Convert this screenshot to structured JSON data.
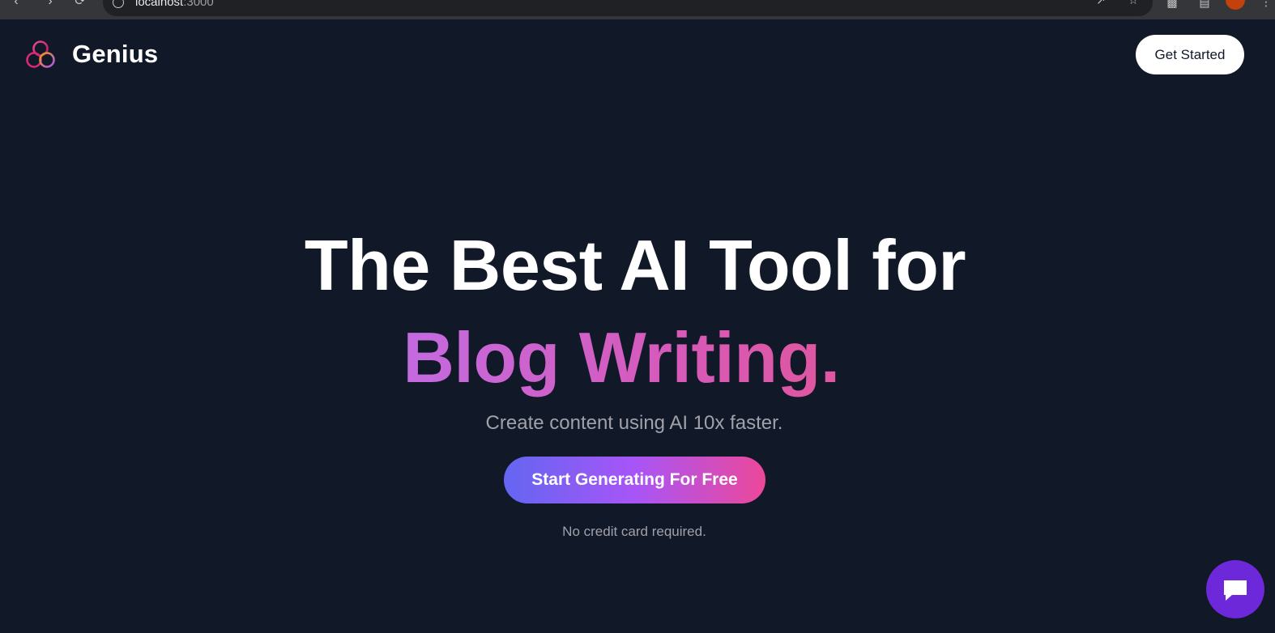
{
  "browser": {
    "url_host": "localhost",
    "url_port": ":3000"
  },
  "header": {
    "brand": "Genius",
    "cta_label": "Get Started"
  },
  "hero": {
    "title_line1": "The Best AI Tool for",
    "title_line2": "Blog Writing.",
    "subtitle": "Create content using AI 10x faster.",
    "primary_cta": "Start Generating For Free",
    "note": "No credit card required."
  },
  "colors": {
    "background": "#111827",
    "gradient_start": "#6366f1",
    "gradient_end": "#ec4899",
    "chat_widget": "#6d28d9"
  },
  "icons": {
    "logo": "three-rings-logo-icon",
    "chat": "chat-bubble-icon"
  }
}
